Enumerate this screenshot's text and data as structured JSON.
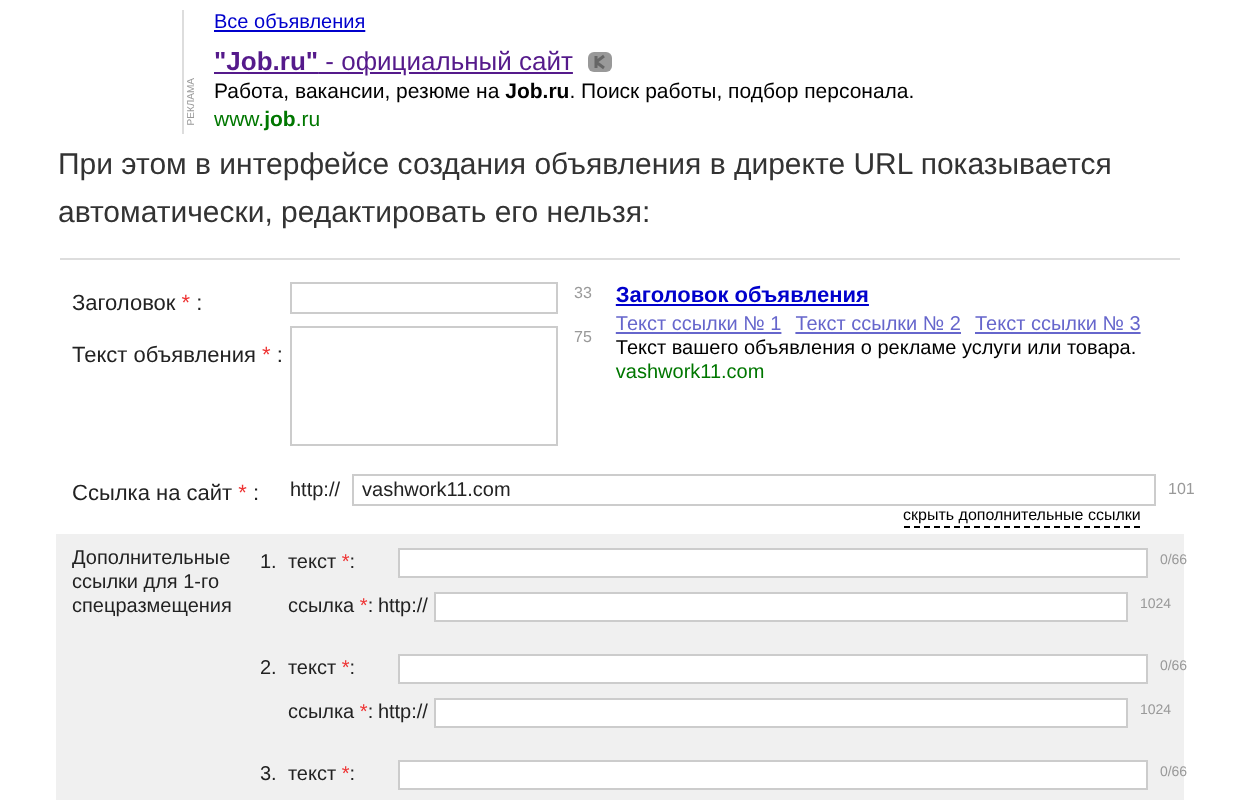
{
  "ad": {
    "side_label": "РЕКЛАМА",
    "all_ads_link": "Все объявления",
    "title": "**\"Job.ru\"** - официальный сайт",
    "text": "Работа, вакансии, резюме на **Job.ru**. Поиск работы, подбор персонала.",
    "url": "www.**job**.ru"
  },
  "paragraph": "При этом в интерфейсе создания объявления в директе URL показывается автоматически, редактировать его нельзя:",
  "form": {
    "title_label": "Заголовок",
    "title_counter": "33",
    "text_label": "Текст объявления",
    "text_counter": "75",
    "required_mark": "*",
    "colon": ":",
    "preview": {
      "title": "Заголовок объявления",
      "links": [
        "Текст ссылки № 1",
        "Текст ссылки № 2",
        "Текст ссылки № 3"
      ],
      "text": "Текст вашего объявления о рекламе услуги или товара.",
      "url": "vashwork11.com"
    },
    "url_label": "Ссылка на сайт",
    "url_prefix": "http://",
    "url_value": "vashwork11.com",
    "url_counter": "101",
    "hide_links": "скрыть дополнительные ссылки"
  },
  "extra": {
    "label": "Дополнительные ссылки для 1-го спецразмещения",
    "items": [
      {
        "number": "1.",
        "text_label": "текст",
        "text_counter": "0/66",
        "link_label": "ссылка",
        "link_prefix": "http://",
        "link_counter": "1024"
      },
      {
        "number": "2.",
        "text_label": "текст",
        "text_counter": "0/66",
        "link_label": "ссылка",
        "link_prefix": "http://",
        "link_counter": "1024"
      },
      {
        "number": "3.",
        "text_label": "текст",
        "text_counter": "0/66"
      }
    ]
  }
}
